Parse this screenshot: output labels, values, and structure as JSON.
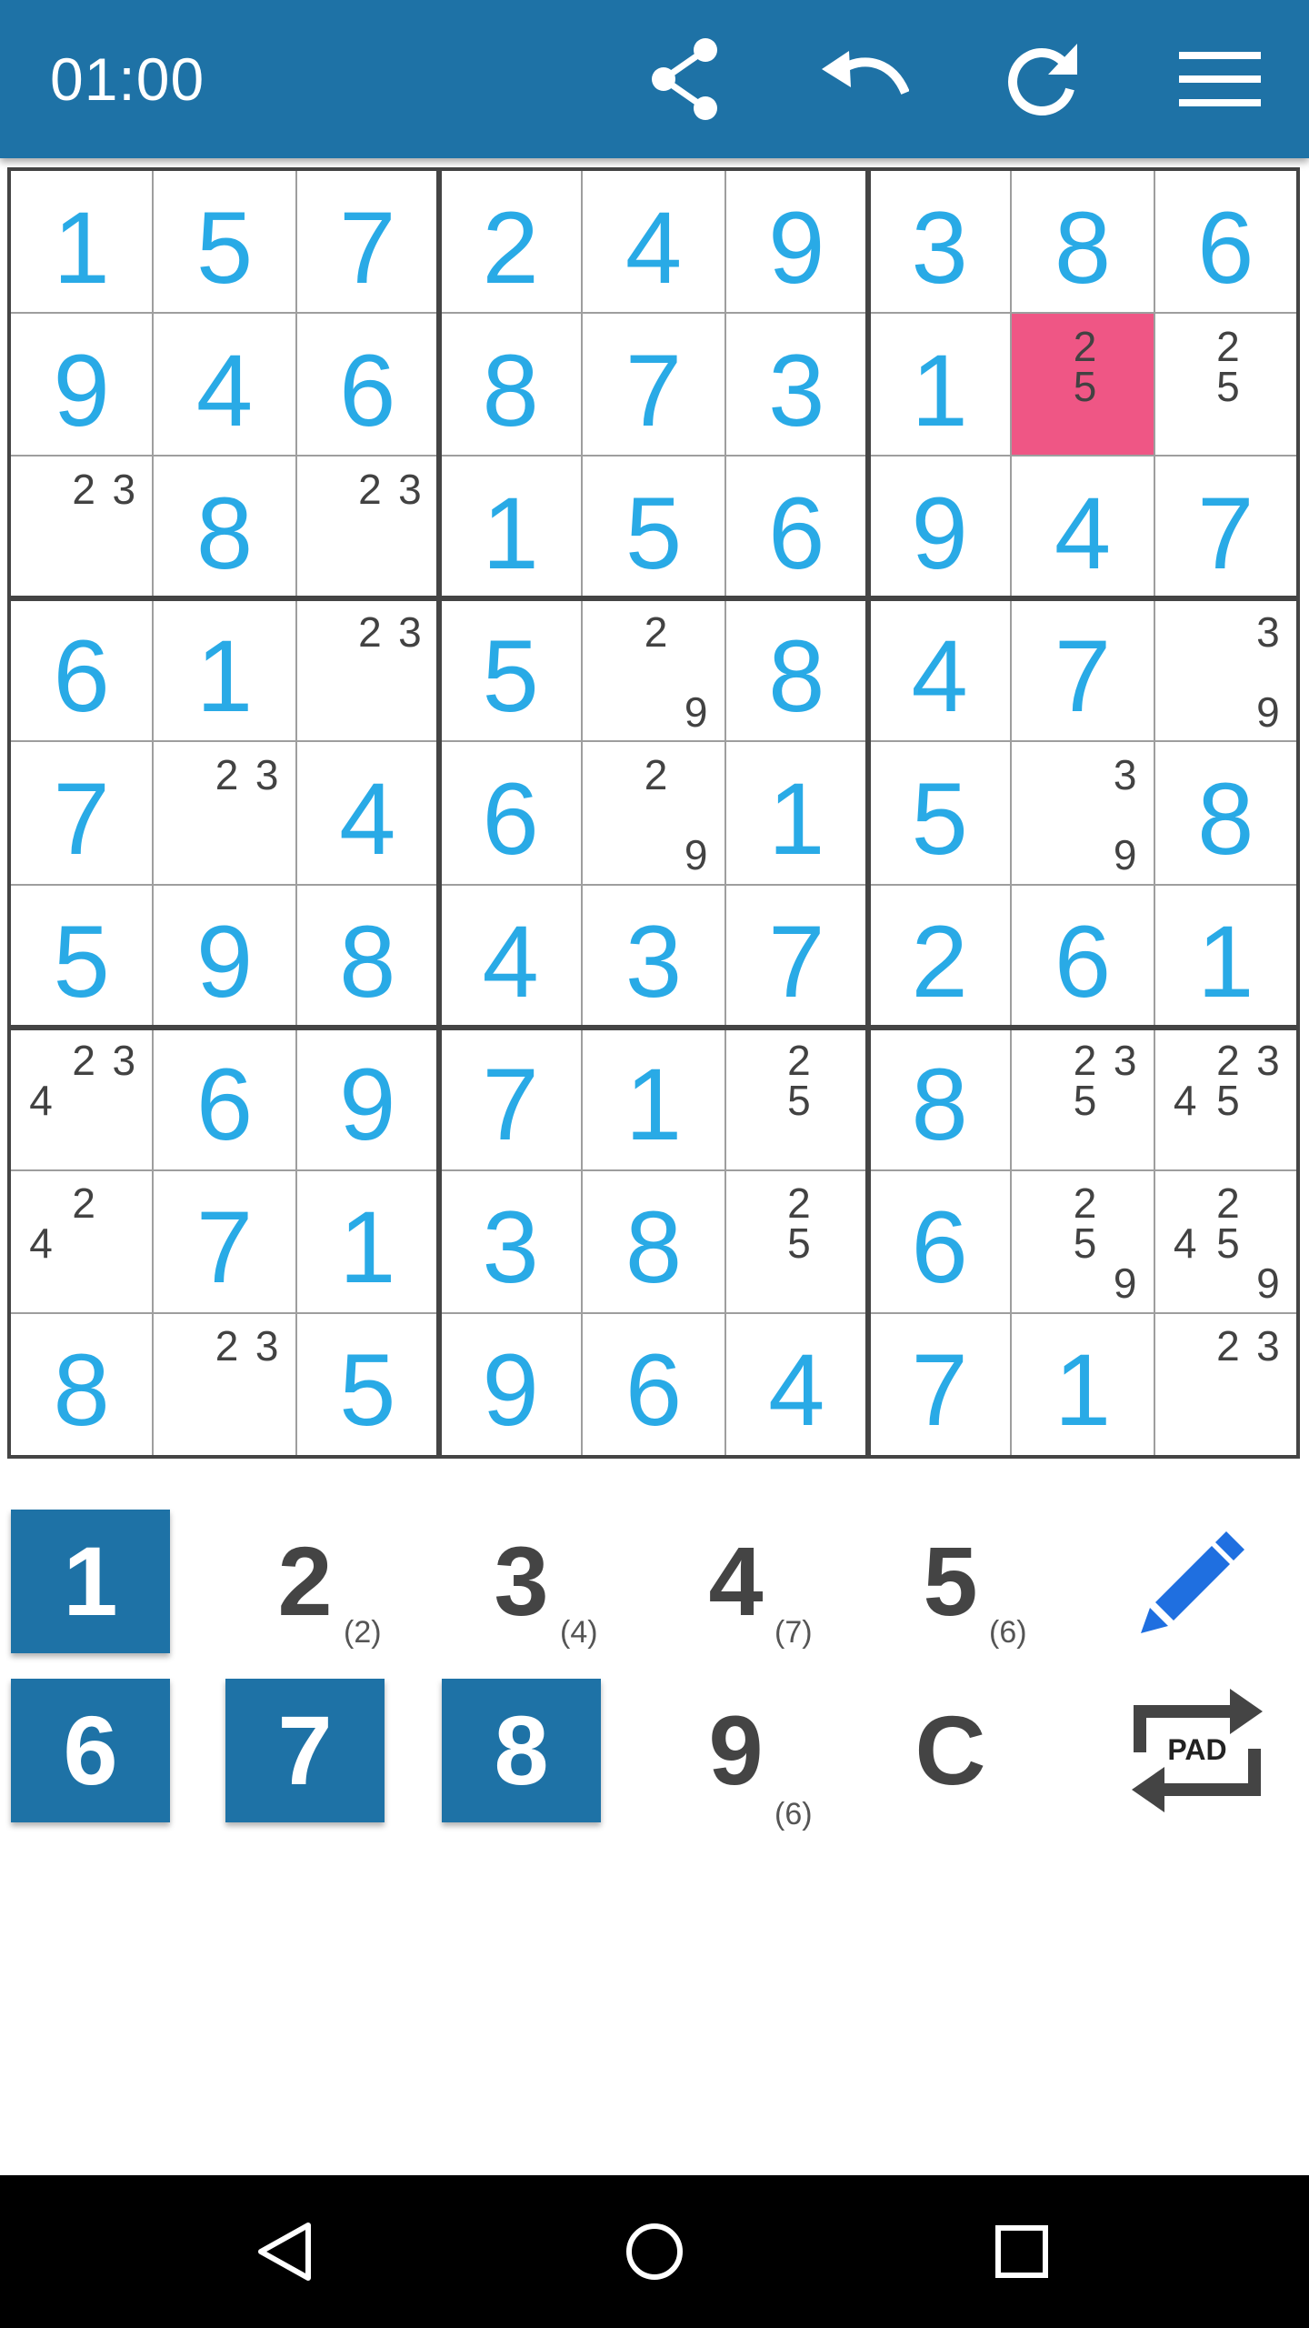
{
  "header": {
    "timer": "01:00",
    "icons": [
      "share-icon",
      "undo-icon",
      "redo-icon",
      "menu-icon"
    ],
    "color": "#1e72a6"
  },
  "board": {
    "selected": [
      1,
      7
    ],
    "grid": [
      [
        {
          "v": "1"
        },
        {
          "v": "5"
        },
        {
          "v": "7"
        },
        {
          "v": "2"
        },
        {
          "v": "4"
        },
        {
          "v": "9"
        },
        {
          "v": "3"
        },
        {
          "v": "8"
        },
        {
          "v": "6"
        }
      ],
      [
        {
          "v": "9"
        },
        {
          "v": "4"
        },
        {
          "v": "6"
        },
        {
          "v": "8"
        },
        {
          "v": "7"
        },
        {
          "v": "3"
        },
        {
          "v": "1"
        },
        {
          "n": [
            "2",
            "5"
          ]
        },
        {
          "n": [
            "2",
            "5"
          ]
        }
      ],
      [
        {
          "n": [
            "2",
            "3"
          ]
        },
        {
          "v": "8"
        },
        {
          "n": [
            "2",
            "3"
          ]
        },
        {
          "v": "1"
        },
        {
          "v": "5"
        },
        {
          "v": "6"
        },
        {
          "v": "9"
        },
        {
          "v": "4"
        },
        {
          "v": "7"
        }
      ],
      [
        {
          "v": "6"
        },
        {
          "v": "1"
        },
        {
          "n": [
            "2",
            "3"
          ]
        },
        {
          "v": "5"
        },
        {
          "n": [
            "2",
            "9"
          ]
        },
        {
          "v": "8"
        },
        {
          "v": "4"
        },
        {
          "v": "7"
        },
        {
          "n": [
            "3",
            "9"
          ]
        }
      ],
      [
        {
          "v": "7"
        },
        {
          "n": [
            "2",
            "3"
          ]
        },
        {
          "v": "4"
        },
        {
          "v": "6"
        },
        {
          "n": [
            "2",
            "9"
          ]
        },
        {
          "v": "1"
        },
        {
          "v": "5"
        },
        {
          "n": [
            "3",
            "9"
          ]
        },
        {
          "v": "8"
        }
      ],
      [
        {
          "v": "5"
        },
        {
          "v": "9"
        },
        {
          "v": "8"
        },
        {
          "v": "4"
        },
        {
          "v": "3"
        },
        {
          "v": "7"
        },
        {
          "v": "2"
        },
        {
          "v": "6"
        },
        {
          "v": "1"
        }
      ],
      [
        {
          "n": [
            "2",
            "3",
            "4"
          ]
        },
        {
          "v": "6"
        },
        {
          "v": "9"
        },
        {
          "v": "7"
        },
        {
          "v": "1"
        },
        {
          "n": [
            "2",
            "5"
          ]
        },
        {
          "v": "8"
        },
        {
          "n": [
            "2",
            "3",
            "5"
          ]
        },
        {
          "n": [
            "2",
            "3",
            "4",
            "5"
          ]
        }
      ],
      [
        {
          "n": [
            "2",
            "4"
          ]
        },
        {
          "v": "7"
        },
        {
          "v": "1"
        },
        {
          "v": "3"
        },
        {
          "v": "8"
        },
        {
          "n": [
            "2",
            "5"
          ]
        },
        {
          "v": "6"
        },
        {
          "n": [
            "2",
            "5",
            "9"
          ]
        },
        {
          "n": [
            "2",
            "4",
            "5",
            "9"
          ]
        }
      ],
      [
        {
          "v": "8"
        },
        {
          "n": [
            "2",
            "3"
          ]
        },
        {
          "v": "5"
        },
        {
          "v": "9"
        },
        {
          "v": "6"
        },
        {
          "v": "4"
        },
        {
          "v": "7"
        },
        {
          "v": "1"
        },
        {
          "n": [
            "2",
            "3"
          ]
        }
      ]
    ]
  },
  "keypad": {
    "keys": [
      {
        "label": "1",
        "count": "",
        "active": true
      },
      {
        "label": "2",
        "count": "(2)",
        "active": false
      },
      {
        "label": "3",
        "count": "(4)",
        "active": false
      },
      {
        "label": "4",
        "count": "(7)",
        "active": false
      },
      {
        "label": "5",
        "count": "(6)",
        "active": false
      },
      {
        "label": "6",
        "count": "",
        "active": true
      },
      {
        "label": "7",
        "count": "",
        "active": true
      },
      {
        "label": "8",
        "count": "",
        "active": true
      },
      {
        "label": "9",
        "count": "(6)",
        "active": false
      },
      {
        "label": "C",
        "count": "",
        "active": false
      }
    ],
    "pencil_icon": "pencil-icon",
    "pad_label": "PAD"
  },
  "navbar": {
    "icons": [
      "back-icon",
      "home-icon",
      "recents-icon"
    ]
  }
}
